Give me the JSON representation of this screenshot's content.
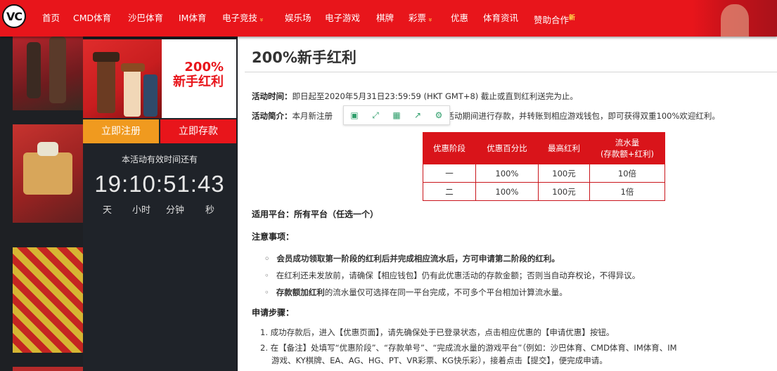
{
  "logo": {
    "text": "VC"
  },
  "nav": {
    "items": [
      {
        "label": "首页",
        "caret": false,
        "new": false
      },
      {
        "label": "CMD体育",
        "caret": false,
        "new": false
      },
      {
        "label": "沙巴体育",
        "caret": false,
        "new": false
      },
      {
        "label": "IM体育",
        "caret": false,
        "new": false
      },
      {
        "label": "电子竞技",
        "caret": true,
        "new": false
      },
      {
        "label": "娱乐场",
        "caret": false,
        "new": false
      },
      {
        "label": "电子游戏",
        "caret": false,
        "new": false
      },
      {
        "label": "棋牌",
        "caret": false,
        "new": false
      },
      {
        "label": "彩票",
        "caret": true,
        "new": false
      },
      {
        "label": "优惠",
        "caret": false,
        "new": false
      },
      {
        "label": "体育资讯",
        "caret": false,
        "new": false
      },
      {
        "label": "赞助合作",
        "caret": false,
        "new": true
      }
    ],
    "new_badge": "新"
  },
  "promo": {
    "banner_line1": "200%",
    "banner_line2": "新手红利",
    "register_label": "立即注册",
    "deposit_label": "立即存款",
    "countdown_label": "本活动有效时间还有",
    "countdown": "19:10:51:43",
    "units": [
      "天",
      "小时",
      "分钟",
      "秒"
    ]
  },
  "content": {
    "title": "200%新手红利",
    "time_label": "活动时间：",
    "time_text": "即日起至2020年5月31日23:59:59 (HKT GMT+8) 截止或直到红利送完为止。",
    "intro_label": "活动简介：",
    "intro_text_a": "本月新注册",
    "intro_text_b": "在活动期间进行存款，并转账到相应游戏钱包，即可获得双重100%欢迎红利。",
    "toolbar_icons": [
      "copy-icon",
      "expand-icon",
      "save-icon",
      "share-icon",
      "settings-icon"
    ],
    "table": {
      "headers": [
        "优惠阶段",
        "优惠百分比",
        "最高红利",
        "流水量\n(存款额+红利)"
      ],
      "rows": [
        [
          "一",
          "100%",
          "100元",
          "10倍"
        ],
        [
          "二",
          "100%",
          "100元",
          "1倍"
        ]
      ]
    },
    "platform": "适用平台：所有平台（任选一个）",
    "notes_title": "注意事项：",
    "notes": [
      "会员成功领取第一阶段的红利后并完成相应流水后，方可申请第二阶段的红利。",
      "在红利还未发放前，请确保【相应钱包】仍有此优惠活动的存款金额；否则当自动弃权论，不得异议。",
      "的流水量仅可选择在同一平台完成，不可多个平台相加计算流水量。"
    ],
    "note3_bold": "存款额加红利",
    "steps_title": "申请步骤：",
    "steps": [
      "1. 成功存款后，进入【优惠页面】，请先确保处于已登录状态，点击相应优惠的【申请优惠】按钮。",
      "2. 在【备注】处填写“优惠阶段”、“存款单号”、“完成流水量的游戏平台”（例如：沙巴体育、CMD体育、IM体育、IM",
      "游戏、KY棋牌、EA、AG、HG、PT、VR彩票、KG快乐彩），接着点击【提交】，便完成申请。"
    ]
  }
}
